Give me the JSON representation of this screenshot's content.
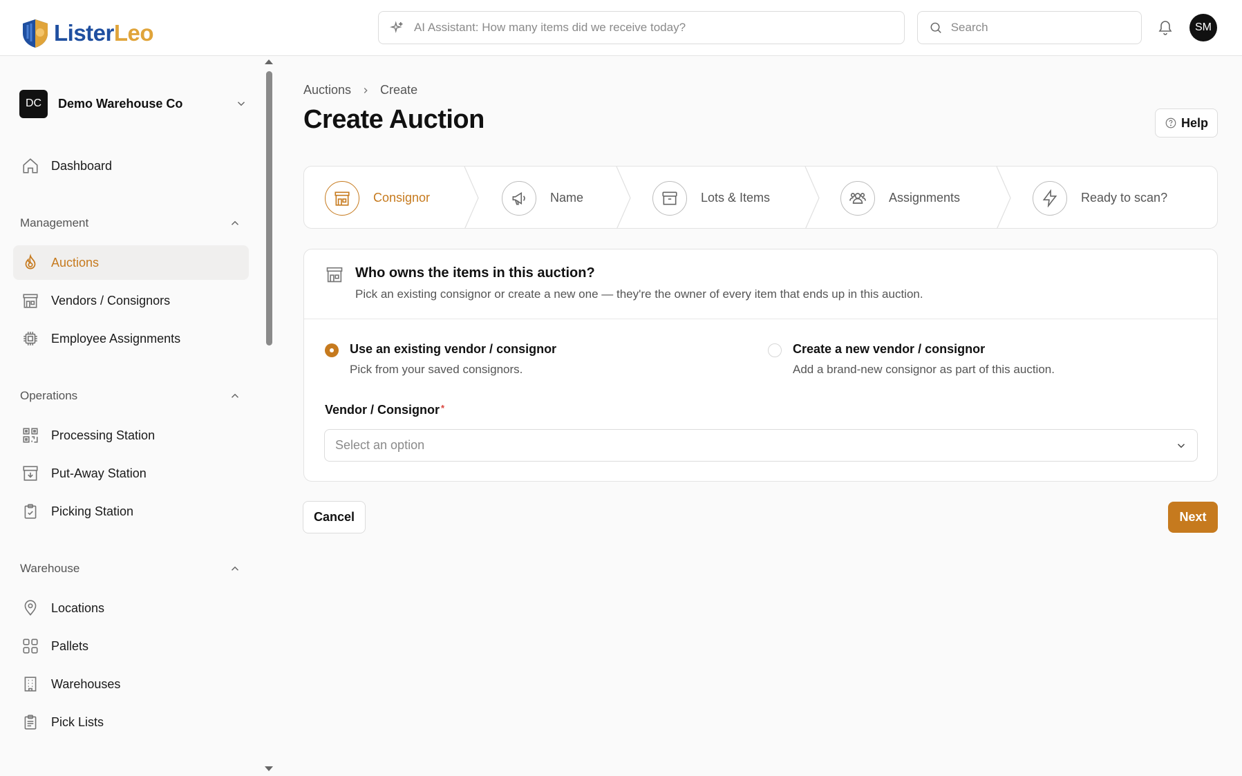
{
  "app": {
    "logo_part1": "Lister",
    "logo_part2": "Leo",
    "brand_accent": "#c67a1e"
  },
  "topbar": {
    "ai_placeholder": "AI Assistant: How many items did we receive today?",
    "search_placeholder": "Search",
    "avatar_initials": "SM"
  },
  "sidebar": {
    "org_initials": "DC",
    "org_name": "Demo Warehouse Co",
    "dashboard": "Dashboard",
    "sections": {
      "management": "Management",
      "operations": "Operations",
      "warehouse": "Warehouse"
    },
    "management_items": [
      "Auctions",
      "Vendors / Consignors",
      "Employee Assignments"
    ],
    "operations_items": [
      "Processing Station",
      "Put-Away Station",
      "Picking Station"
    ],
    "warehouse_items": [
      "Locations",
      "Pallets",
      "Warehouses",
      "Pick Lists"
    ]
  },
  "main": {
    "breadcrumb": [
      "Auctions",
      "Create"
    ],
    "title": "Create Auction",
    "help_label": "Help",
    "steps": [
      "Consignor",
      "Name",
      "Lots & Items",
      "Assignments",
      "Ready to scan?"
    ],
    "active_step": 0,
    "card": {
      "title": "Who owns the items in this auction?",
      "description": "Pick an existing consignor or create a new one — they're the owner of every item that ends up in this auction.",
      "option_existing_label": "Use an existing vendor / consignor",
      "option_existing_sub": "Pick from your saved consignors.",
      "option_new_label": "Create a new vendor / consignor",
      "option_new_sub": "Add a brand-new consignor as part of this auction.",
      "selected_option": "existing",
      "field_label": "Vendor / Consignor",
      "field_required_mark": "*",
      "select_placeholder": "Select an option"
    },
    "cancel_label": "Cancel",
    "next_label": "Next"
  }
}
